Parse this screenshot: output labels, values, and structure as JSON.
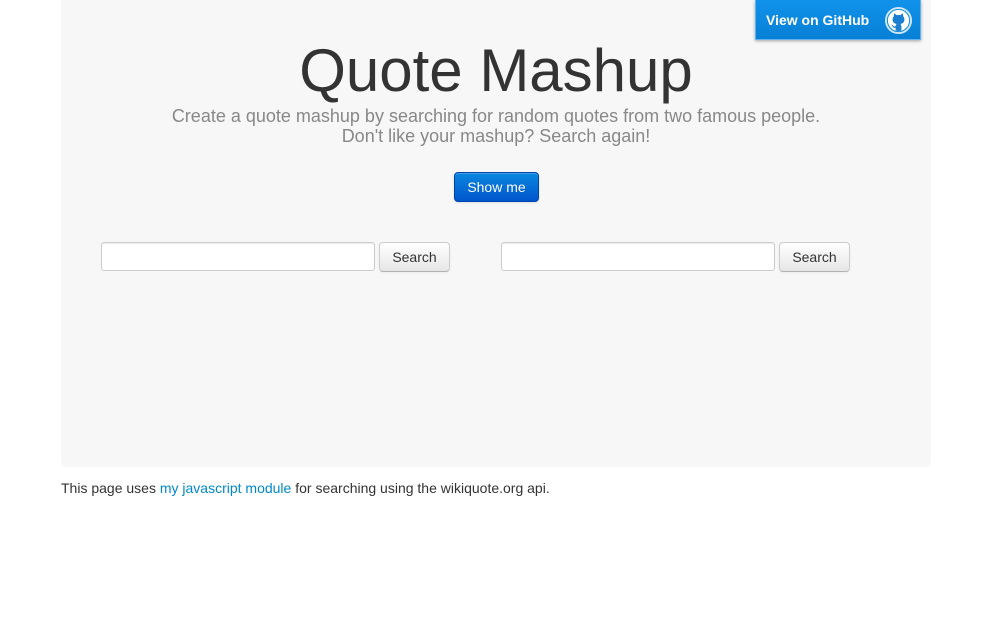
{
  "hero": {
    "title": "Quote Mashup",
    "subtitle_line1": "Create a quote mashup by searching for random quotes from two famous people.",
    "subtitle_line2": "Don't like your mashup? Search again!",
    "show_button_label": "Show me"
  },
  "search_left": {
    "value": "",
    "placeholder": "",
    "button_label": "Search"
  },
  "search_right": {
    "value": "",
    "placeholder": "",
    "button_label": "Search"
  },
  "github": {
    "label": "View on GitHub",
    "icon": "github-octocat-icon"
  },
  "footer": {
    "text_before": "This page uses ",
    "link_text": "my javascript module",
    "text_after": " for searching using the wikiquote.org api."
  },
  "colors": {
    "hero_background": "#f7f7f7",
    "primary_button": "#0077d9",
    "github_ribbon": "#0a88e0",
    "link": "#0088cc"
  }
}
